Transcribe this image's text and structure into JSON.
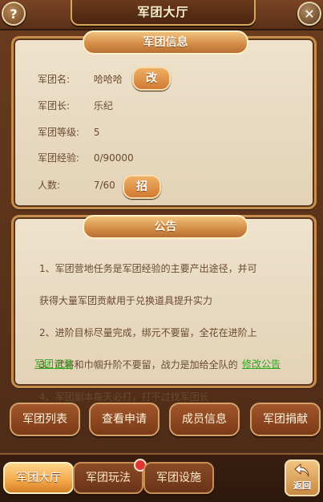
{
  "header": {
    "title": "军团大厅",
    "help_label": "?",
    "close_label": "✕"
  },
  "info": {
    "title": "军团信息",
    "name_label": "军团名:",
    "name_value": "哈哈哈",
    "rename_button": "改",
    "leader_label": "军团长:",
    "leader_value": "乐纪",
    "level_label": "军团等级:",
    "level_value": "5",
    "exp_label": "军团经验:",
    "exp_value": "0/90000",
    "members_label": "人数:",
    "members_value": "7/60",
    "recruit_button": "招"
  },
  "notice": {
    "title": "公告",
    "lines": [
      "1、军团营地任务是军团经验的主要产出途径，并可",
      "获得大量军团贡献用于兑换道具提升实力",
      "2、进阶目标尽量完成，绑元不要留，全花在进阶上",
      "3、武将和巾帼升阶不要留，战力是加给全队的",
      "4、军团副本每天必打，打不过找军团长"
    ],
    "log_link": "军团记录",
    "edit_link": "修改公告"
  },
  "actions": {
    "list": "军团列表",
    "applications": "查看申请",
    "members": "成员信息",
    "donate": "军团捐献"
  },
  "tabs": {
    "hall": "军团大厅",
    "gameplay": "军团玩法",
    "facilities": "军团设施"
  },
  "back": {
    "label": "返回"
  },
  "icons": {
    "help": "help-icon",
    "close": "close-icon",
    "back": "back-arrow-icon",
    "notification": "red-dot-badge"
  }
}
